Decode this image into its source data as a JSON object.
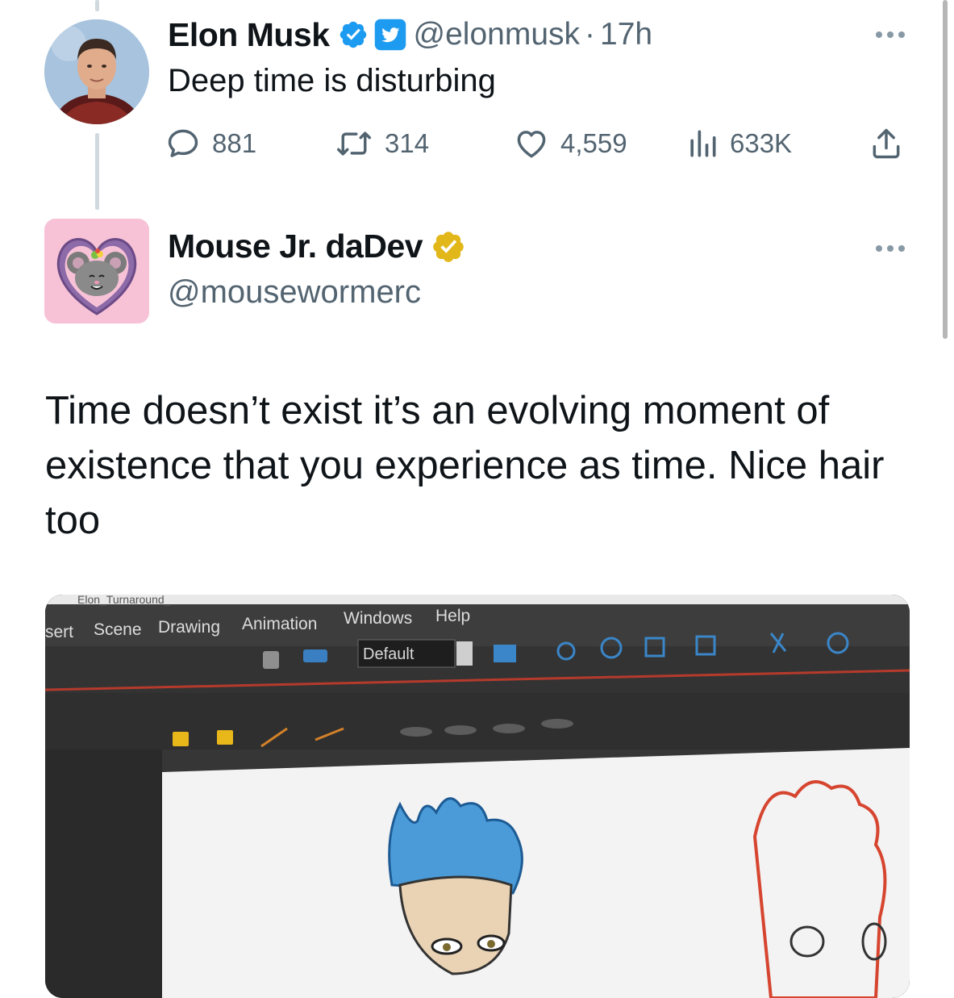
{
  "tweet1": {
    "name": "Elon Musk",
    "handle": "@elonmusk",
    "separator": "·",
    "time": "17h",
    "text": "Deep time is disturbing",
    "stats": {
      "replies": "881",
      "reposts": "314",
      "likes": "4,559",
      "views": "633K"
    }
  },
  "tweet2": {
    "name": "Mouse Jr. daDev",
    "handle": "@mousewormerc",
    "text": "Time doesn’t exist it’s an evolving moment of existence that you experience as time. Nice hair too"
  },
  "media": {
    "file_tab": "Elon_Turnaround_",
    "menu": [
      "sert",
      "Scene",
      "Drawing",
      "Animation",
      "Windows",
      "Help"
    ],
    "workspace_select": "Default"
  },
  "colors": {
    "verified_blue": "#1d9bf0",
    "verified_gold": "#e2b719",
    "text_primary": "#0f1419",
    "text_secondary": "#536471",
    "thread_line": "#cfd9de"
  },
  "icons": [
    "reply-icon",
    "repost-icon",
    "like-icon",
    "views-icon",
    "share-icon",
    "more-icon",
    "verified-badge-icon",
    "twitter-bird-icon"
  ]
}
